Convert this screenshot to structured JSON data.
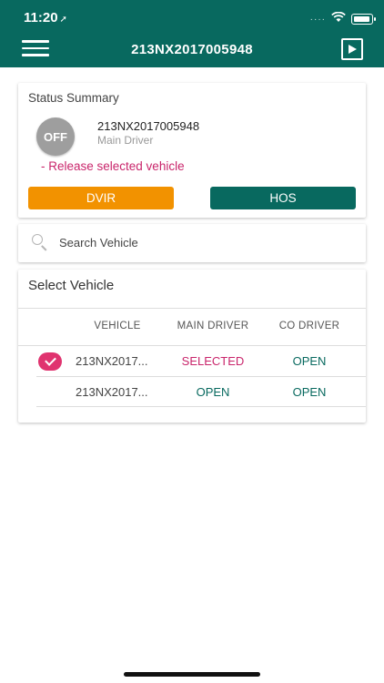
{
  "status_bar": {
    "time": "11:20",
    "location_arrow": "➚",
    "signal": "····",
    "wifi": "⌔"
  },
  "header": {
    "title": "213NX2017005948",
    "menu_icon": "hamburger-icon",
    "video_icon": "video-play-icon",
    "bg_color": "#08695f"
  },
  "status_summary": {
    "title": "Status Summary",
    "status_badge": "OFF",
    "vehicle_id": "213NX2017005948",
    "driver_role": "Main Driver",
    "release_link": "- Release selected vehicle",
    "dvir_label": "DVIR",
    "hos_label": "HOS"
  },
  "search": {
    "placeholder": "Search Vehicle"
  },
  "select_vehicle": {
    "title": "Select Vehicle",
    "columns": [
      "VEHICLE",
      "MAIN DRIVER",
      "CO DRIVER"
    ],
    "rows": [
      {
        "vehicle": "213NX2017...",
        "main_driver": "SELECTED",
        "co_driver": "OPEN",
        "checked": true
      },
      {
        "vehicle": "213NX2017...",
        "main_driver": "OPEN",
        "co_driver": "OPEN",
        "checked": false
      }
    ]
  },
  "colors": {
    "primary": "#08695f",
    "accent_orange": "#f29200",
    "accent_pink": "#c9256b"
  }
}
